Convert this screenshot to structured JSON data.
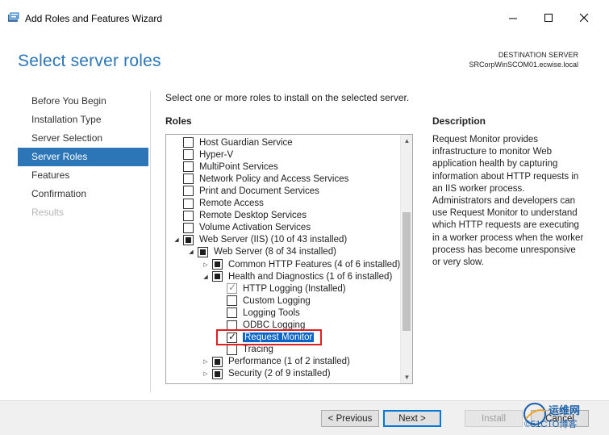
{
  "window": {
    "title": "Add Roles and Features Wizard",
    "minimize_icon": "minimize-icon",
    "maximize_icon": "maximize-icon",
    "close_icon": "close-icon"
  },
  "header": {
    "page_title": "Select server roles",
    "destination_label": "DESTINATION SERVER",
    "destination_server": "SRCorpWinSCOM01.ecwise.local"
  },
  "nav": {
    "items": [
      {
        "label": "Before You Begin",
        "state": "normal"
      },
      {
        "label": "Installation Type",
        "state": "normal"
      },
      {
        "label": "Server Selection",
        "state": "normal"
      },
      {
        "label": "Server Roles",
        "state": "active"
      },
      {
        "label": "Features",
        "state": "normal"
      },
      {
        "label": "Confirmation",
        "state": "normal"
      },
      {
        "label": "Results",
        "state": "disabled"
      }
    ]
  },
  "main": {
    "instruction": "Select one or more roles to install on the selected server.",
    "roles_label": "Roles",
    "description_label": "Description",
    "description_text": "Request Monitor provides infrastructure to monitor Web application health by capturing information about HTTP requests in an IIS worker process. Administrators and developers can use Request Monitor to understand which HTTP requests are executing in a worker process when the worker process has become unresponsive or very slow.",
    "roles": [
      {
        "label": "Host Guardian Service",
        "level": 0,
        "expander": "",
        "check": "unchecked"
      },
      {
        "label": "Hyper-V",
        "level": 0,
        "expander": "",
        "check": "unchecked"
      },
      {
        "label": "MultiPoint Services",
        "level": 0,
        "expander": "",
        "check": "unchecked"
      },
      {
        "label": "Network Policy and Access Services",
        "level": 0,
        "expander": "",
        "check": "unchecked"
      },
      {
        "label": "Print and Document Services",
        "level": 0,
        "expander": "",
        "check": "unchecked"
      },
      {
        "label": "Remote Access",
        "level": 0,
        "expander": "",
        "check": "unchecked"
      },
      {
        "label": "Remote Desktop Services",
        "level": 0,
        "expander": "",
        "check": "unchecked"
      },
      {
        "label": "Volume Activation Services",
        "level": 0,
        "expander": "",
        "check": "unchecked"
      },
      {
        "label": "Web Server (IIS) (10 of 43 installed)",
        "level": 0,
        "expander": "expanded",
        "check": "partial"
      },
      {
        "label": "Web Server (8 of 34 installed)",
        "level": 1,
        "expander": "expanded",
        "check": "partial"
      },
      {
        "label": "Common HTTP Features (4 of 6 installed)",
        "level": 2,
        "expander": "collapsed",
        "check": "partial"
      },
      {
        "label": "Health and Diagnostics (1 of 6 installed)",
        "level": 2,
        "expander": "expanded",
        "check": "partial"
      },
      {
        "label": "HTTP Logging (Installed)",
        "level": 3,
        "expander": "",
        "check": "checked-disabled"
      },
      {
        "label": "Custom Logging",
        "level": 3,
        "expander": "",
        "check": "unchecked"
      },
      {
        "label": "Logging Tools",
        "level": 3,
        "expander": "",
        "check": "unchecked"
      },
      {
        "label": "ODBC Logging",
        "level": 3,
        "expander": "",
        "check": "unchecked"
      },
      {
        "label": "Request Monitor",
        "level": 3,
        "expander": "",
        "check": "checked",
        "selected": true
      },
      {
        "label": "Tracing",
        "level": 3,
        "expander": "",
        "check": "unchecked"
      },
      {
        "label": "Performance (1 of 2 installed)",
        "level": 2,
        "expander": "collapsed",
        "check": "partial"
      },
      {
        "label": "Security (2 of 9 installed)",
        "level": 2,
        "expander": "collapsed",
        "check": "partial"
      }
    ]
  },
  "footer": {
    "previous_label": "< Previous",
    "next_label": "Next >",
    "install_label": "Install",
    "cancel_label": "Cancel"
  },
  "watermark": {
    "line1": "运维网",
    "line2": "©51CTO博客"
  },
  "colors": {
    "accent": "#2c76b7",
    "selection": "#0a64c8",
    "highlight_box": "#e02020"
  }
}
